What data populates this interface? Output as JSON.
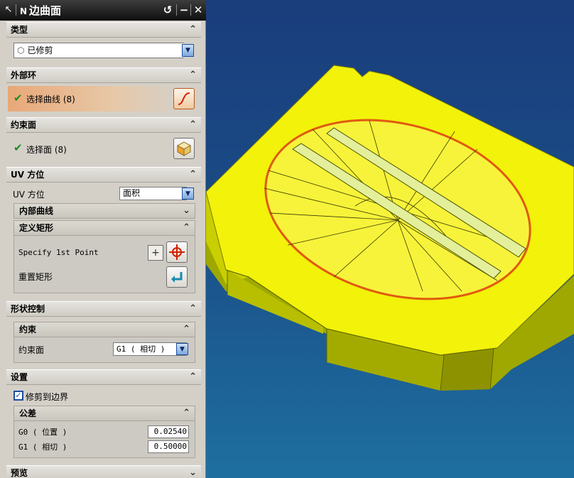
{
  "dialog": {
    "title": "边曲面",
    "title_prefix_icon": "N",
    "tool_icon": "arrow-select-icon",
    "buttons": {
      "reset": "↺",
      "minimize": "−",
      "close": "✕"
    }
  },
  "type_section": {
    "header": "类型",
    "dropdown_value": "已修剪"
  },
  "outer_loop": {
    "header": "外部环",
    "item_label": "选择曲线 (8)"
  },
  "constraint_face": {
    "header": "约束面",
    "item_label": "选择面 (8)"
  },
  "uv_orientation": {
    "header": "UV 方位",
    "label": "UV 方位",
    "dropdown_value": "面积",
    "inner_curves_header": "内部曲线",
    "define_rect_header": "定义矩形",
    "specify_point_label": "Specify 1st Point",
    "reset_rect_label": "重置矩形"
  },
  "shape_control": {
    "header": "形状控制",
    "constraint_subheader": "约束",
    "constraint_face_label": "约束面",
    "constraint_face_value": "G1 ( 相切 )"
  },
  "settings": {
    "header": "设置",
    "trim_to_boundary_label": "修剪到边界",
    "trim_to_boundary_checked": true,
    "tolerance_header": "公差",
    "g0_label": "G0 ( 位置 )",
    "g0_value": "0.02540",
    "g1_label": "G1 ( 相切 )",
    "g1_value": "0.50000"
  },
  "preview": {
    "header": "预览"
  },
  "colors": {
    "part_yellow": "#f2f20a",
    "edge_orange": "#e05a10",
    "background_blue": "#1a4c86"
  }
}
